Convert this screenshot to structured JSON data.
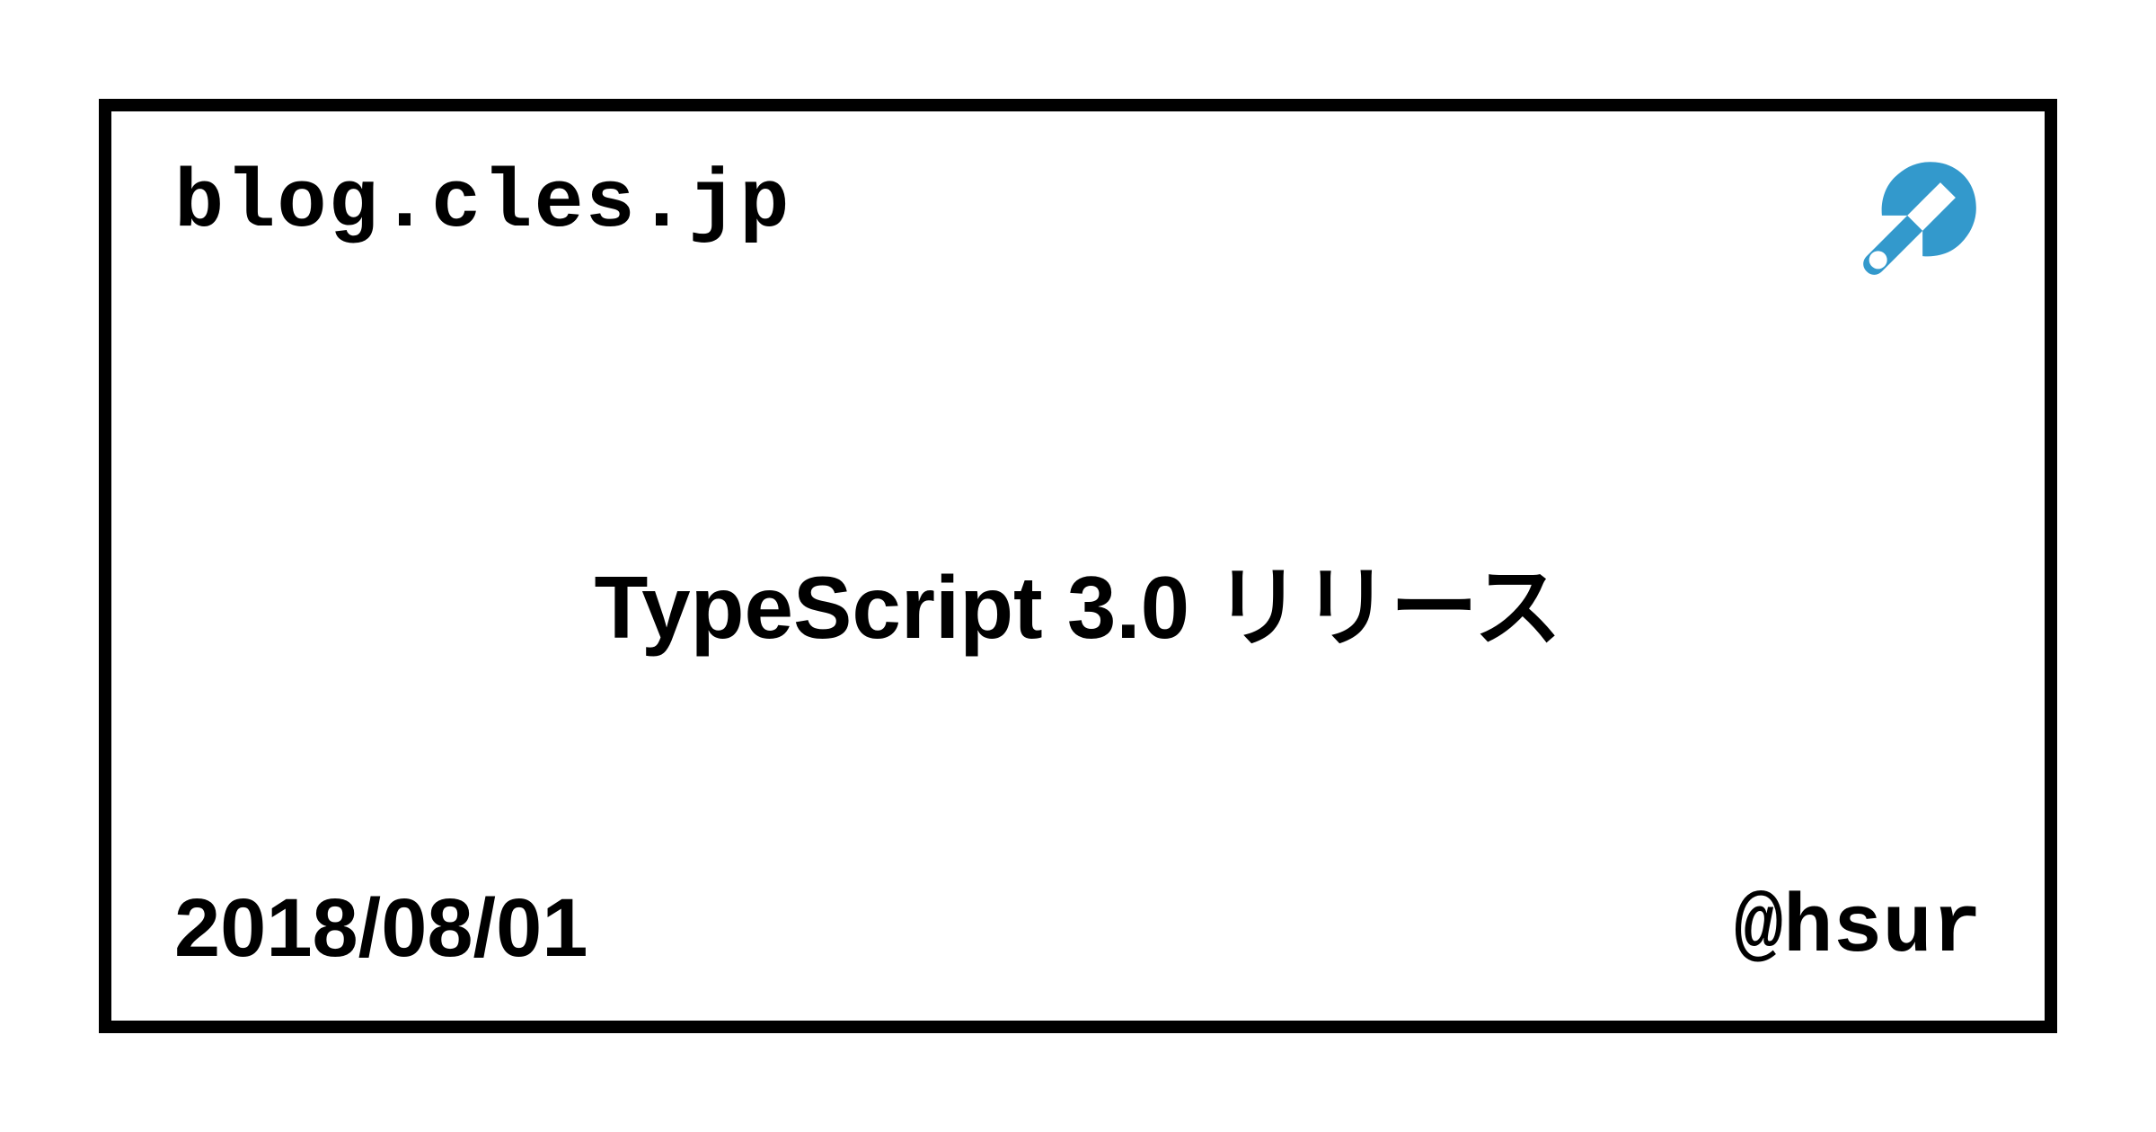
{
  "header": {
    "site_name": "blog.cles.jp",
    "icon": "wrench-icon"
  },
  "main": {
    "title": "TypeScript 3.0 リリース"
  },
  "footer": {
    "date": "2018/08/01",
    "handle": "@hsur"
  },
  "colors": {
    "accent": "#3399cc"
  }
}
